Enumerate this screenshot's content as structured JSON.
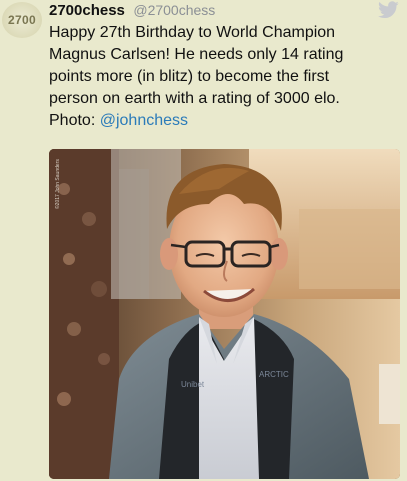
{
  "tweet": {
    "avatar_text": "2700",
    "display_name": "2700chess",
    "handle": "@2700chess",
    "text_lines": [
      "Happy 27th Birthday to World Champion",
      "Magnus Carlsen! He needs only 14 rating",
      "points more (in blitz) to become the first",
      "person on earth with a rating of 3000 elo."
    ],
    "photo_label": "Photo:",
    "photo_credit_handle": "@johnchess",
    "photo_watermark": "©2017 John Saunders",
    "bird_icon": "twitter-bird-icon"
  },
  "colors": {
    "background": "#e9e9cd",
    "link": "#2b7bb9",
    "handle_gray": "#8b8f95",
    "bird_gray": "#c9cbcf"
  }
}
